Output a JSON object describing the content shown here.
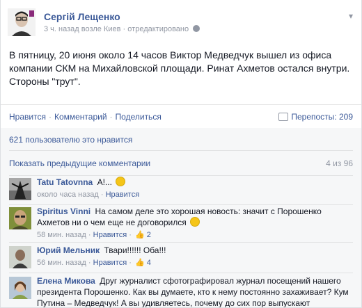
{
  "post": {
    "author": "Сергій Лещенко",
    "time": "3 ч. назад",
    "location": "возле Киев",
    "edited": "отредактировано",
    "dot": "·",
    "text": "В пятницу, 20 июня около 14 часов Виктор Медведчук вышел из офиса компании СКМ на Михайловской площади. Ринат Ахметов остался внутри. Стороны \"трут\".",
    "chevron": "▾"
  },
  "actions": {
    "like": "Нравится",
    "comment": "Комментарий",
    "share": "Поделиться",
    "dot": "·",
    "shares": "Перепосты: 209"
  },
  "likes_summary": "621 пользователю это нравится",
  "prev_comments": {
    "label": "Показать предыдущие комментарии",
    "count": "4 из 96"
  },
  "comments": [
    {
      "name": "Tatu Tatovnna",
      "text": "А!...",
      "time": "около часа назад",
      "like": "Нравится",
      "likes": ""
    },
    {
      "name": "Spiritus Vinni",
      "text": "На самом деле это хорошая новость: значит с Порошенко Ахметов ни о чем еще не договорился",
      "time": "58 мин. назад",
      "like": "Нравится",
      "likes": "2"
    },
    {
      "name": "Юрий Мельник",
      "text": "Твари!!!!!! Оба!!!",
      "time": "56 мин. назад",
      "like": "Нравится",
      "likes": "4"
    },
    {
      "name": "Елена Микова",
      "text": "Друг журналист сфотографировал журнал посещений нашего президента Порошенко. Как вы думаете, кто к нему постоянно захаживает? Кум Путина – Медведчук! А вы удивляетесь, почему до сих пор выпускают",
      "time": "",
      "like": "",
      "likes": ""
    }
  ],
  "icons": {
    "globe": "globe-icon",
    "share": "share-icon",
    "thumb": "thumbs-up-icon",
    "smile": "smiley-emoticon-icon"
  },
  "colors": {
    "link": "#3b5998",
    "meta": "#9197a3",
    "feedback_bg": "#f6f7f8"
  }
}
